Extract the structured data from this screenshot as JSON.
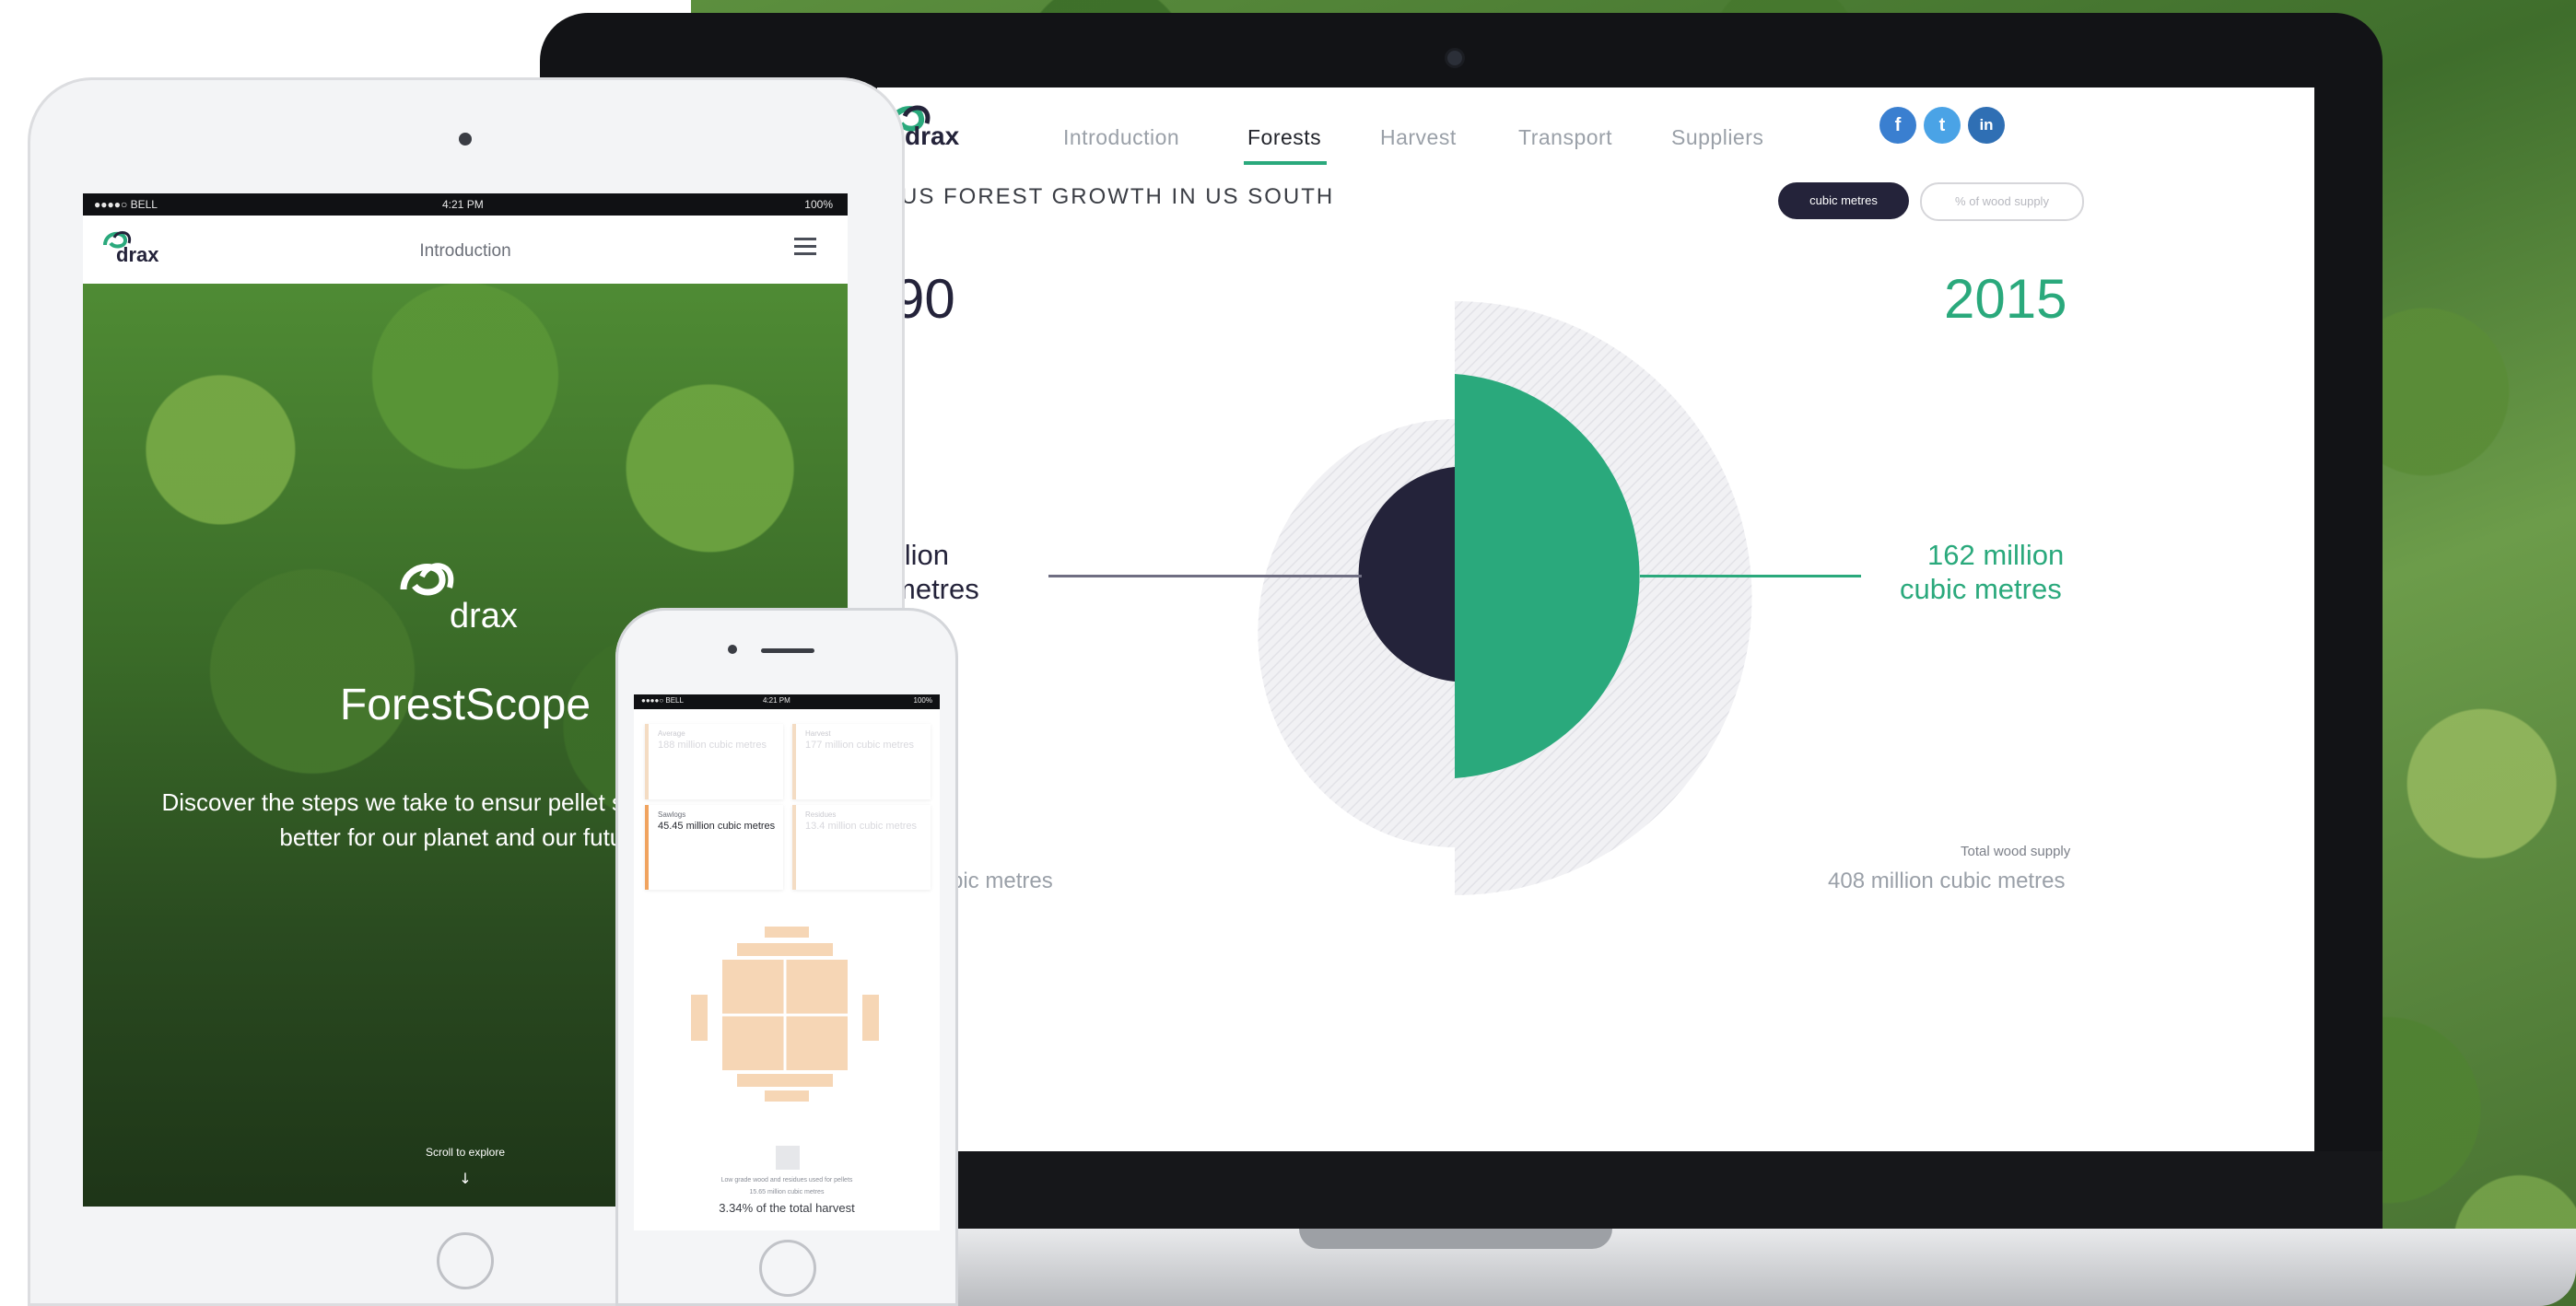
{
  "colors": {
    "accent": "#2aa97c",
    "dark": "#24233a",
    "peach": "#f6d6b5",
    "social": "#3a7fd0"
  },
  "laptop": {
    "brand": "drax",
    "nav": {
      "items": [
        "Introduction",
        "Forests",
        "Harvest",
        "Transport",
        "Suppliers"
      ],
      "active": "Forests"
    },
    "social": {
      "icons": [
        "facebook-icon",
        "twitter-icon",
        "linkedin-icon"
      ],
      "labels": [
        "f",
        "t",
        "in"
      ]
    },
    "section_title": "US FOREST GROWTH IN US SOUTH",
    "toggle": {
      "cubic": "cubic metres",
      "percent": "% of wood supply"
    },
    "year_left": "90",
    "year_right": "2015",
    "left_value_line1": "illion",
    "left_value_line2": "metres",
    "right_value_line1": "162 million",
    "right_value_line2": "cubic metres",
    "left_total": "bic metres",
    "right_total_label": "Total wood supply",
    "right_total": "408 million cubic metres"
  },
  "tablet": {
    "status_left": "●●●●○ BELL",
    "status_time": "4:21 PM",
    "status_battery": "100%",
    "brand": "drax",
    "header_title": "Introduction",
    "hero_brand": "drax",
    "hero_title": "ForestScope",
    "hero_text": "Discover the steps we take to ensur pellet supply chain is better for our planet and our future.",
    "scroll_label": "Scroll to explore",
    "scroll_arrow": "↓"
  },
  "phone": {
    "status_left": "●●●●○ BELL",
    "status_time": "4:21 PM",
    "status_battery": "100%",
    "cards": [
      {
        "label": "Average",
        "value": "188 million cubic metres"
      },
      {
        "label": "Harvest",
        "value": "177 million cubic metres"
      },
      {
        "label": "Sawlogs",
        "value": "45.45 million cubic metres"
      },
      {
        "label": "Residues",
        "value": "13.4 million cubic metres"
      }
    ],
    "footer_line1": "Low grade wood and residues used for pellets",
    "footer_line2": "15.65 million cubic metres",
    "footer_line3": "3.34% of the total harvest"
  }
}
